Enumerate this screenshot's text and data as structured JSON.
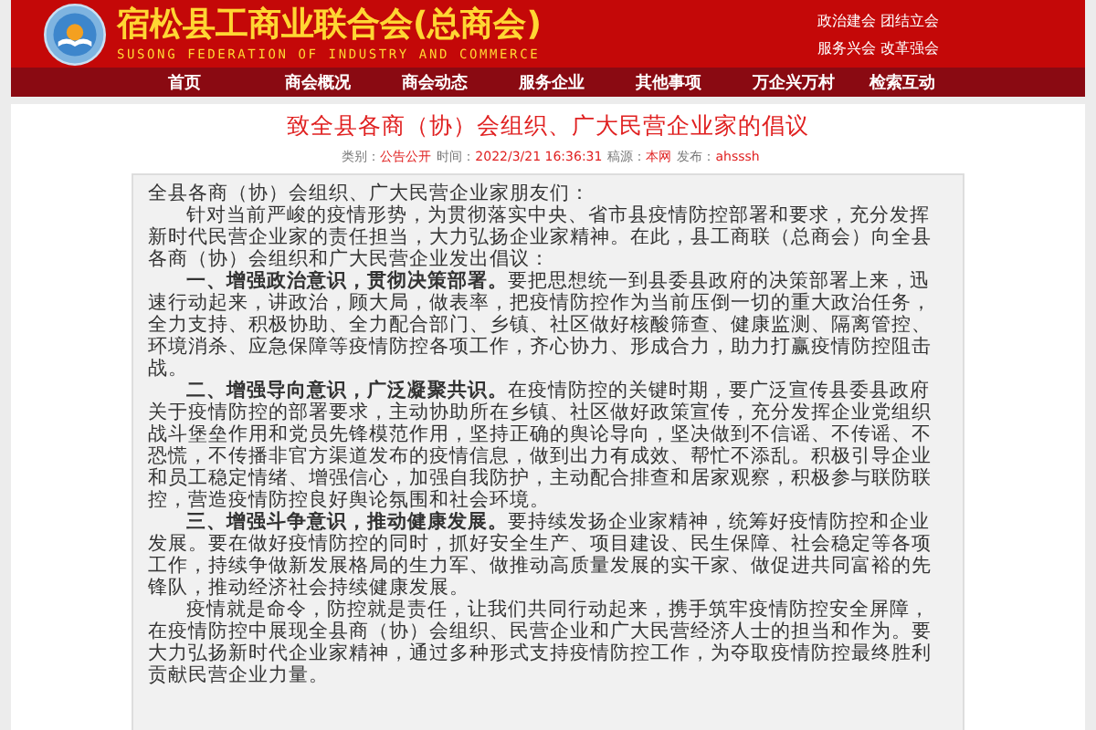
{
  "header": {
    "title": "宿松县工商业联合会(总商会)",
    "subtitle": "SUSONG FEDERATION OF INDUSTRY AND COMMERCE",
    "slogans": [
      "政治建会 团结立会",
      "服务兴会 改革强会"
    ]
  },
  "nav": [
    "首页",
    "商会概况",
    "商会动态",
    "服务企业",
    "其他事项",
    "万企兴万村",
    "检索互动"
  ],
  "article": {
    "title": "致全县各商（协）会组织、广大民营企业家的倡议",
    "meta": [
      {
        "label": "类别：",
        "value": "公告公开"
      },
      {
        "label": "时间：",
        "value": "2022/3/21 16:36:31"
      },
      {
        "label": "稿源：",
        "value": "本网"
      },
      {
        "label": "发布：",
        "value": "ahsssh"
      }
    ],
    "greeting": "全县各商（协）会组织、广大民营企业家朋友们：",
    "paragraphs": [
      "针对当前严峻的疫情形势，为贯彻落实中央、省市县疫情防控部署和要求，充分发挥新时代民营企业家的责任担当，大力弘扬企业家精神。在此，县工商联（总商会）向全县各商（协）会组织和广大民营企业发出倡议：",
      "**一、增强政治意识，贯彻决策部署。**要把思想统一到县委县政府的决策部署上来，迅速行动起来，讲政治，顾大局，做表率，把疫情防控作为当前压倒一切的重大政治任务，全力支持、积极协助、全力配合部门、乡镇、社区做好核酸筛查、健康监测、隔离管控、环境消杀、应急保障等疫情防控各项工作，齐心协力、形成合力，助力打赢疫情防控阻击战。",
      "**二、增强导向意识，广泛凝聚共识。**在疫情防控的关键时期，要广泛宣传县委县政府关于疫情防控的部署要求，主动协助所在乡镇、社区做好政策宣传，充分发挥企业党组织战斗堡垒作用和党员先锋模范作用，坚持正确的舆论导向，坚决做到不信谣、不传谣、不恐慌，不传播非官方渠道发布的疫情信息，做到出力有成效、帮忙不添乱。积极引导企业和员工稳定情绪、增强信心，加强自我防护，主动配合排查和居家观察，积极参与联防联控，营造疫情防控良好舆论氛围和社会环境。",
      "**三、增强斗争意识，推动健康发展。**要持续发扬企业家精神，统筹好疫情防控和企业发展。要在做好疫情防控的同时，抓好安全生产、项目建设、民生保障、社会稳定等各项工作，持续争做新发展格局的生力军、做推动高质量发展的实干家、做促进共同富裕的先锋队，推动经济社会持续健康发展。",
      "疫情就是命令，防控就是责任，让我们共同行动起来，携手筑牢疫情防控安全屏障，在疫情防控中展现全县商（协）会组织、民营企业和广大民营经济人士的担当和作为。要大力弘扬新时代企业家精神，通过多种形式支持疫情防控工作，为夺取疫情防控最终胜利贡献民营企业力量。"
    ]
  }
}
